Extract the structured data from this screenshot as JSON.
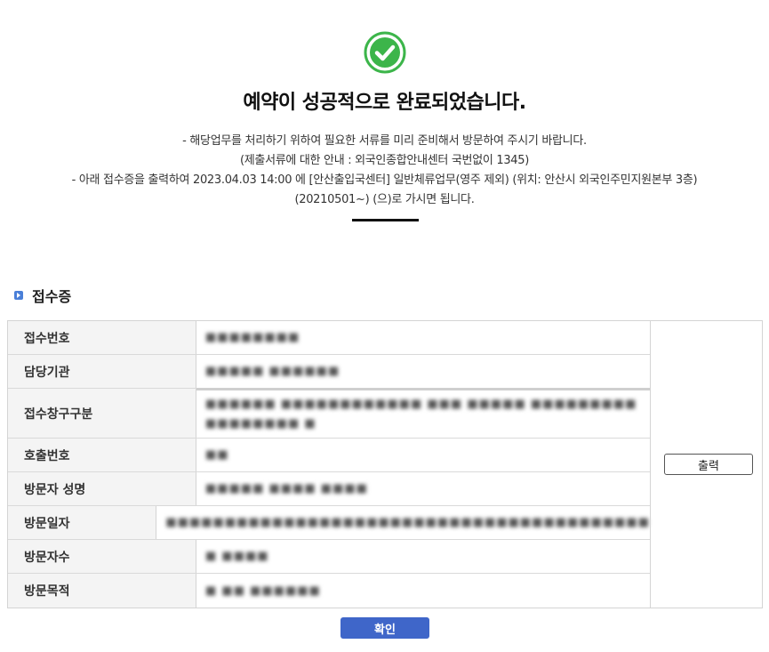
{
  "header": {
    "title": "예약이 성공적으로 완료되었습니다.",
    "notice_lines": [
      "- 해당업무를 처리하기 위하여 필요한 서류를 미리 준비해서 방문하여 주시기 바랍니다.",
      "(제출서류에 대한 안내 : 외국인종합안내센터 국번없이 1345)",
      "- 아래 접수증을 출력하여 2023.04.03 14:00 에 [안산출입국센터] 일반체류업무(영주 제외) (위치: 안산시 외국인주민지원본부 3층)",
      "(20210501~) (으)로 가시면 됩니다."
    ],
    "success_color": "#3cb54a"
  },
  "receipt": {
    "section_title": "접수증",
    "rows": [
      {
        "label": "접수번호",
        "value": "■■■■■■■■"
      },
      {
        "label": "담당기관",
        "value": "■■■■■ ■■■■■■"
      },
      {
        "label": "접수창구구분",
        "value": "■■■■■■ ■■■■■■■■■■■■ ■■■ ■■■■■ ■■■■■■■■■ ■■■■■■■■ ■"
      },
      {
        "label": "호출번호",
        "value": "■■"
      },
      {
        "label": "방문자 성명",
        "value": "■■■■■ ■■■■ ■■■■"
      },
      {
        "label": "방문일자",
        "value": "■■■■■■■■■■■■■■■■■■■■■■■■■■■■■■■■■■■■■■■■■"
      },
      {
        "label": "방문자수",
        "value": "■ ■■■■"
      },
      {
        "label": "방문목적",
        "value": "■ ■■ ■■■■■■"
      }
    ],
    "print_label": "출력"
  },
  "footer": {
    "confirm_label": "확인",
    "confirm_color": "#3f66c9"
  }
}
